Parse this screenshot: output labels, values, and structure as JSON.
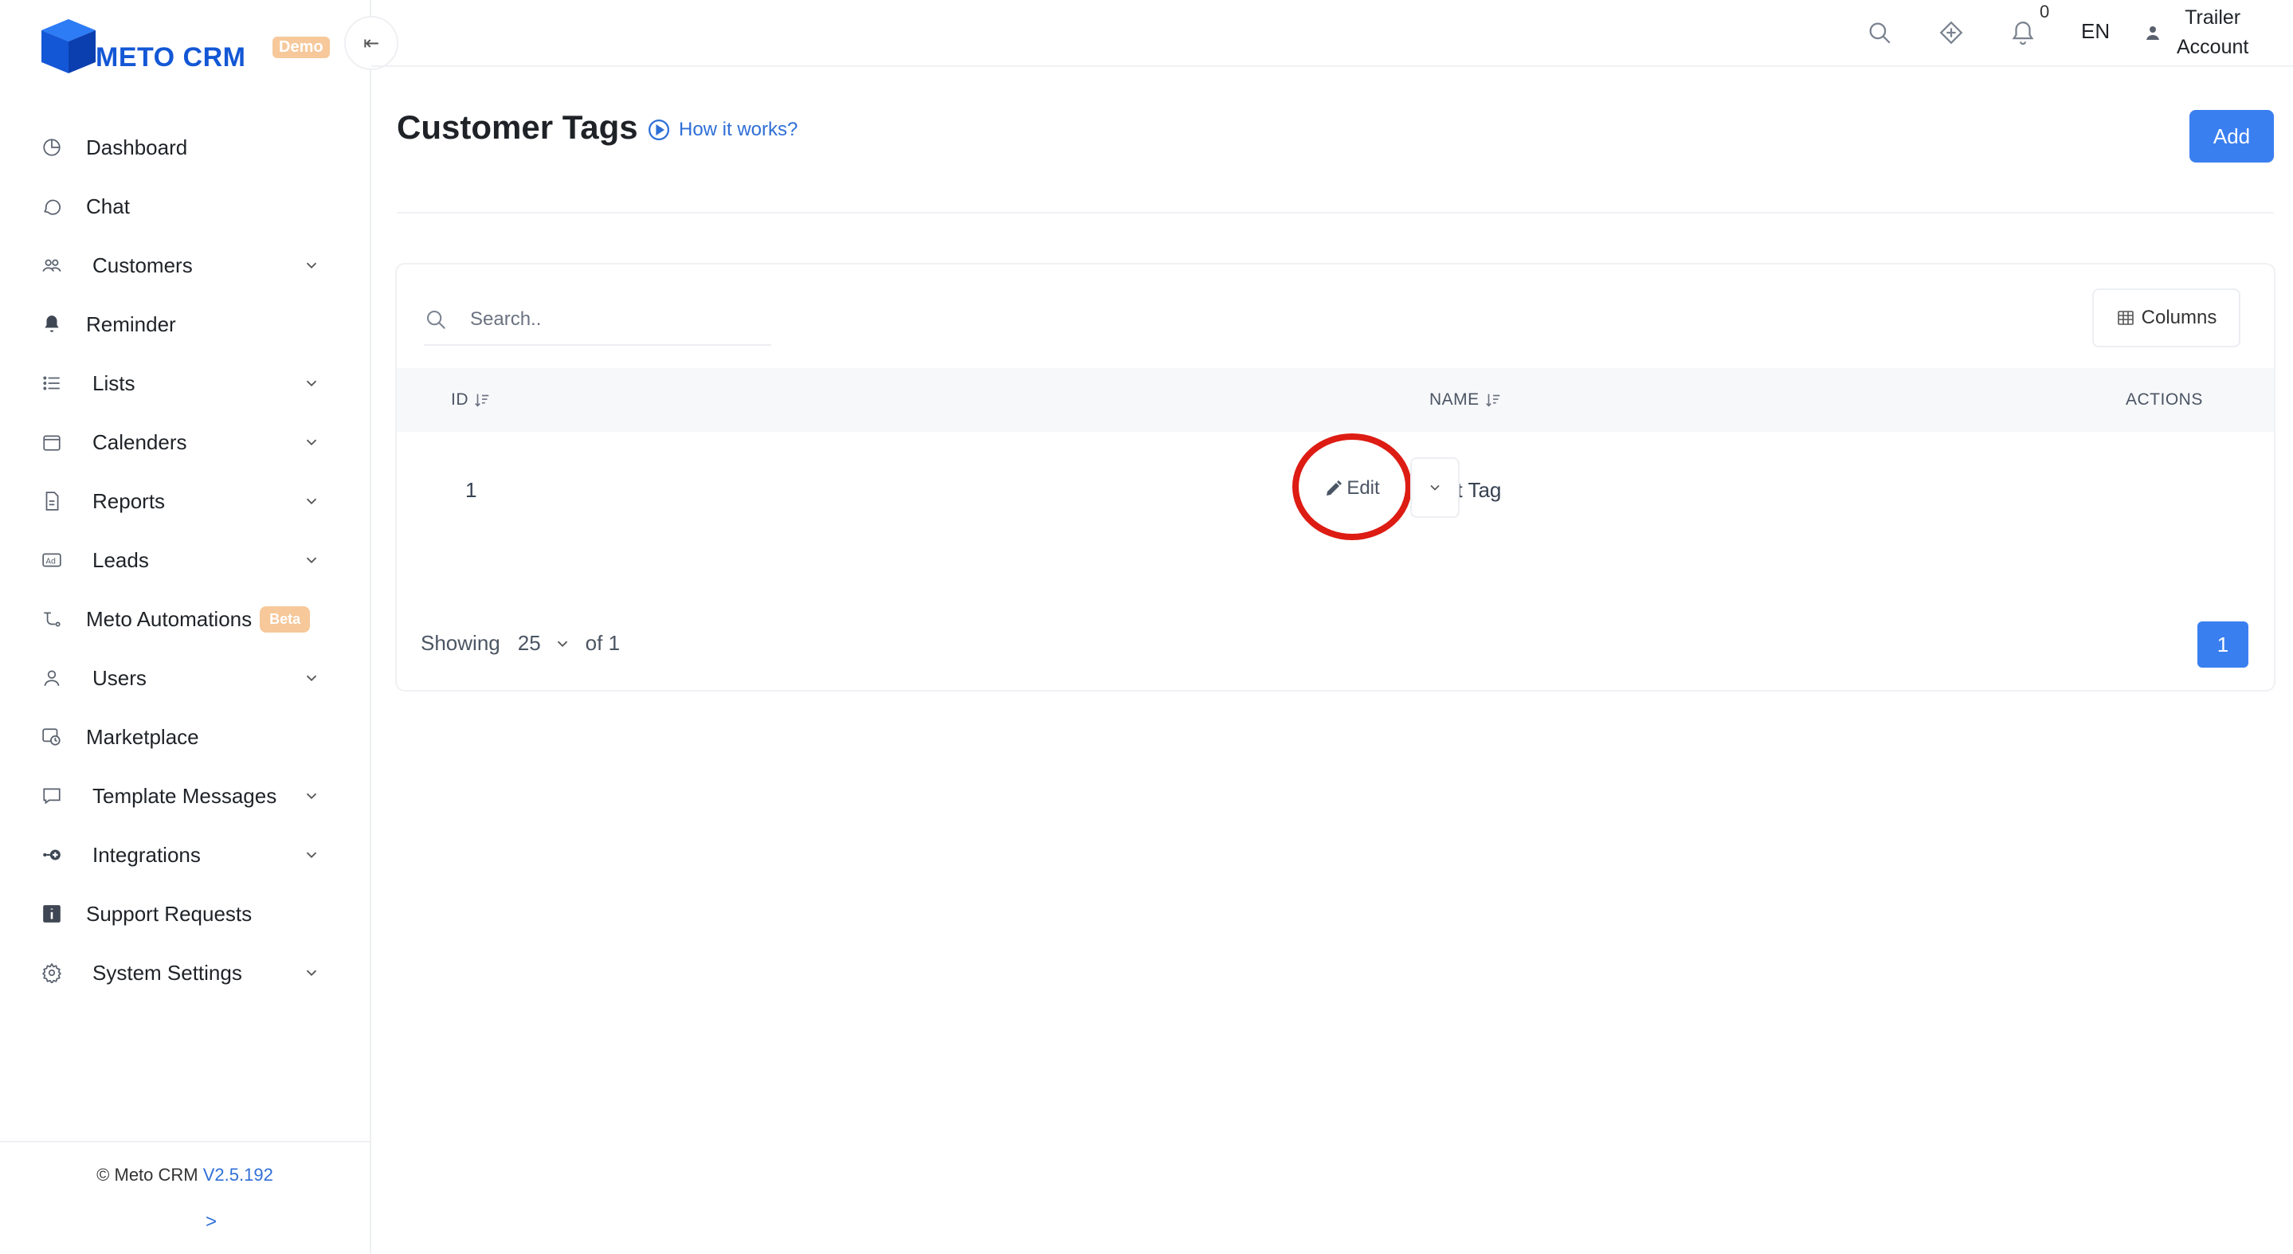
{
  "app": {
    "logo_text": "METO CRM",
    "logo_badge": "Demo",
    "brand_color": "#1457d6",
    "accent_color": "#3a7ff0",
    "highlight_color": "#dd1c14"
  },
  "sidebar": {
    "items": [
      {
        "label": "Dashboard",
        "icon": "dashboard-icon"
      },
      {
        "label": "Chat",
        "icon": "chat-icon"
      },
      {
        "label": "Customers",
        "icon": "customers-icon",
        "submenu": true
      },
      {
        "label": "Reminder",
        "icon": "bell-icon"
      },
      {
        "label": "Lists",
        "icon": "list-icon",
        "submenu": true
      },
      {
        "label": "Calenders",
        "icon": "calendar-icon",
        "submenu": true
      },
      {
        "label": "Reports",
        "icon": "report-icon",
        "submenu": true
      },
      {
        "label": "Leads",
        "icon": "ad-icon",
        "submenu": true
      },
      {
        "label": "Meto Automations",
        "icon": "automation-icon",
        "badge": "Beta"
      },
      {
        "label": "Users",
        "icon": "user-icon",
        "submenu": true
      },
      {
        "label": "Marketplace",
        "icon": "marketplace-icon"
      },
      {
        "label": "Template Messages",
        "icon": "message-icon",
        "submenu": true
      },
      {
        "label": "Integrations",
        "icon": "integration-icon",
        "submenu": true
      },
      {
        "label": "Support Requests",
        "icon": "info-icon"
      },
      {
        "label": "System Settings",
        "icon": "gear-icon",
        "submenu": true
      }
    ],
    "footer": {
      "copyright": "© Meto CRM",
      "version": "V2.5.192",
      "expand": ">"
    },
    "collapse_symbol": "⇤"
  },
  "topbar": {
    "notification_count": "0",
    "language": "EN",
    "account_line1": "Trailer",
    "account_line2": "Account"
  },
  "page": {
    "title": "Customer Tags",
    "how_it_works": "How it works?",
    "add_label": "Add"
  },
  "table": {
    "search_placeholder": "Search..",
    "columns_label": "Columns",
    "headers": {
      "id": "ID",
      "name": "NAME",
      "actions": "ACTIONS"
    },
    "rows": [
      {
        "id": "1",
        "name": "Test Tag",
        "edit_label": "Edit"
      }
    ]
  },
  "pagination": {
    "showing_label": "Showing",
    "page_size": "25",
    "of_label": "of 1",
    "current_page": "1"
  }
}
